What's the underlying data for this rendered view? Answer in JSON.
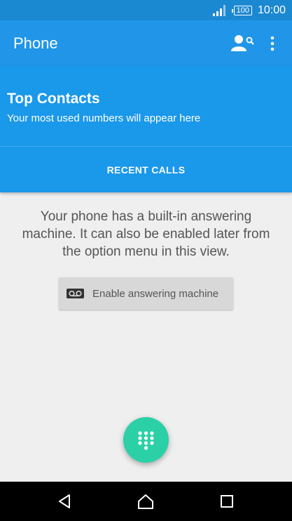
{
  "status_bar": {
    "battery": "100",
    "time": "10:00",
    "icons": [
      "signal-icon",
      "battery-icon"
    ]
  },
  "app_bar": {
    "title": "Phone",
    "icons": [
      "contact-search-icon",
      "overflow-menu-icon"
    ]
  },
  "top_contacts": {
    "title": "Top Contacts",
    "subtitle": "Your most used numbers will appear here"
  },
  "tabs": {
    "recent_calls": "RECENT CALLS"
  },
  "main": {
    "info_text": "Your phone has a built-in answering machine. It can also be enabled later from the option menu in this view.",
    "enable_button_label": "Enable answering machine",
    "enable_button_icon": "voicemail-icon"
  },
  "fab": {
    "icon": "dialpad-icon"
  },
  "nav_bar": {
    "icons": [
      "back-icon",
      "home-icon",
      "recents-icon"
    ]
  },
  "colors": {
    "status_bar": "#1b88d2",
    "app_bar": "#2196e8",
    "header_panel": "#1a98ea",
    "fab": "#2bd0a6",
    "background": "#efefef"
  }
}
